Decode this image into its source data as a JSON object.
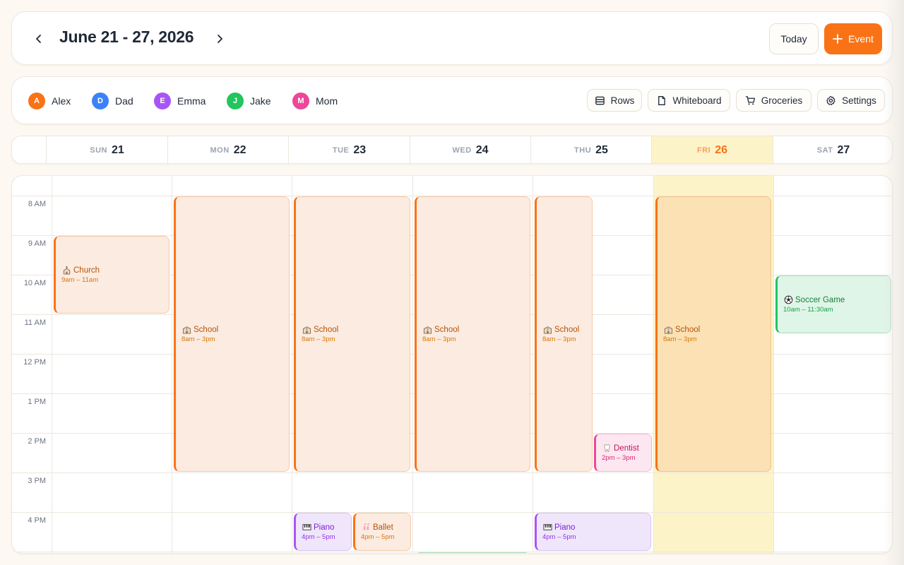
{
  "header": {
    "range_title": "June 21 - 27, 2026",
    "today_label": "Today",
    "event_label": "Event",
    "accent": "#f97316"
  },
  "members": [
    {
      "initial": "A",
      "name": "Alex",
      "color": "#f97316"
    },
    {
      "initial": "D",
      "name": "Dad",
      "color": "#3b82f6"
    },
    {
      "initial": "E",
      "name": "Emma",
      "color": "#a855f7"
    },
    {
      "initial": "J",
      "name": "Jake",
      "color": "#22c55e"
    },
    {
      "initial": "M",
      "name": "Mom",
      "color": "#ec4899"
    }
  ],
  "tools": [
    {
      "label": "Rows",
      "icon": "rows-icon"
    },
    {
      "label": "Whiteboard",
      "icon": "whiteboard-icon"
    },
    {
      "label": "Groceries",
      "icon": "cart-icon"
    },
    {
      "label": "Settings",
      "icon": "gear-icon"
    }
  ],
  "days": [
    {
      "dow": "SUN",
      "num": "21",
      "today": false
    },
    {
      "dow": "MON",
      "num": "22",
      "today": false
    },
    {
      "dow": "TUE",
      "num": "23",
      "today": false
    },
    {
      "dow": "WED",
      "num": "24",
      "today": false
    },
    {
      "dow": "THU",
      "num": "25",
      "today": false
    },
    {
      "dow": "FRI",
      "num": "26",
      "today": true
    },
    {
      "dow": "SAT",
      "num": "27",
      "today": false
    }
  ],
  "hours": [
    "8 AM",
    "9 AM",
    "10 AM",
    "11 AM",
    "12 PM",
    "1 PM",
    "2 PM",
    "3 PM",
    "4 PM"
  ],
  "events": [
    {
      "title": "Church",
      "time": "9am – 11am",
      "day": 0,
      "start": 9,
      "end": 11,
      "color": "orange",
      "icon": "church-icon"
    },
    {
      "title": "School",
      "time": "8am – 3pm",
      "day": 1,
      "start": 8,
      "end": 15,
      "color": "orange",
      "icon": "school-icon"
    },
    {
      "title": "School",
      "time": "8am – 3pm",
      "day": 2,
      "start": 8,
      "end": 15,
      "color": "orange",
      "icon": "school-icon"
    },
    {
      "title": "Piano",
      "time": "4pm – 5pm",
      "day": 2,
      "start": 16,
      "end": 17,
      "color": "purple",
      "icon": "piano-icon",
      "split": 0
    },
    {
      "title": "Ballet",
      "time": "4pm – 5pm",
      "day": 2,
      "start": 16,
      "end": 17,
      "color": "orange",
      "icon": "ballet-icon",
      "split": 1
    },
    {
      "title": "School",
      "time": "8am – 3pm",
      "day": 3,
      "start": 8,
      "end": 15,
      "color": "orange",
      "icon": "school-icon"
    },
    {
      "title": "",
      "time": "",
      "day": 3,
      "start": 17,
      "end": 18,
      "color": "green",
      "icon": ""
    },
    {
      "title": "School",
      "time": "8am – 3pm",
      "day": 4,
      "start": 8,
      "end": 15,
      "color": "orange",
      "icon": "school-icon",
      "split": 0
    },
    {
      "title": "Dentist",
      "time": "2pm – 3pm",
      "day": 4,
      "start": 14,
      "end": 15,
      "color": "pink",
      "icon": "tooth-icon",
      "split": 1
    },
    {
      "title": "Piano",
      "time": "4pm – 5pm",
      "day": 4,
      "start": 16,
      "end": 17,
      "color": "purple",
      "icon": "piano-icon"
    },
    {
      "title": "School",
      "time": "8am – 3pm",
      "day": 5,
      "start": 8,
      "end": 15,
      "color": "orange-today",
      "icon": "school-icon"
    },
    {
      "title": "Soccer Game",
      "time": "10am – 11:30am",
      "day": 6,
      "start": 10,
      "end": 11.5,
      "color": "green",
      "icon": "soccer-icon"
    }
  ]
}
